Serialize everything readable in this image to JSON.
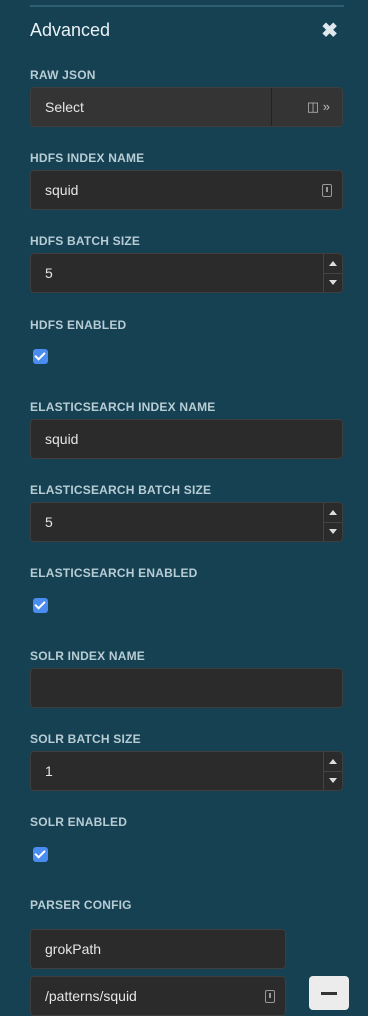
{
  "panel": {
    "title": "Advanced"
  },
  "raw_json": {
    "label": "RAW JSON",
    "value": "Select"
  },
  "hdfs": {
    "index_label": "HDFS INDEX NAME",
    "index_value": "squid",
    "batch_label": "HDFS BATCH SIZE",
    "batch_value": "5",
    "enabled_label": "HDFS ENABLED",
    "enabled": true
  },
  "elasticsearch": {
    "index_label": "ELASTICSEARCH INDEX NAME",
    "index_value": "squid",
    "batch_label": "ELASTICSEARCH BATCH SIZE",
    "batch_value": "5",
    "enabled_label": "ELASTICSEARCH ENABLED",
    "enabled": true
  },
  "solr": {
    "index_label": "SOLR INDEX NAME",
    "index_value": "",
    "batch_label": "SOLR BATCH SIZE",
    "batch_value": "1",
    "enabled_label": "SOLR ENABLED",
    "enabled": true
  },
  "parser_config": {
    "label": "PARSER CONFIG",
    "key": "grokPath",
    "value": "/patterns/squid"
  },
  "icons": {
    "close": "close-icon",
    "columns": "columns-icon",
    "expand": "double-chevron-right-icon",
    "key": "key-icon",
    "minus": "minus-icon"
  },
  "colors": {
    "background": "#154153",
    "field": "#2b2b2b",
    "checkbox": "#4a8cf0"
  }
}
